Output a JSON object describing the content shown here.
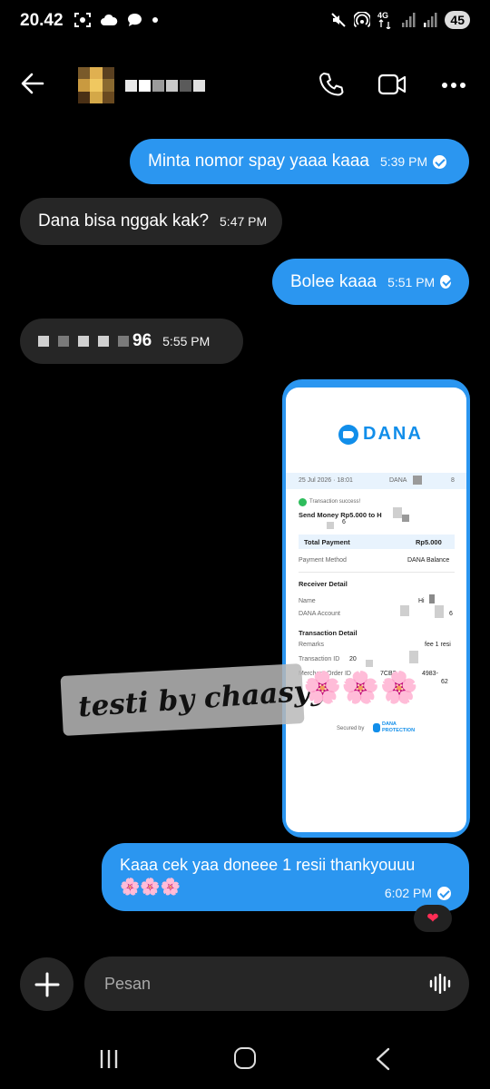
{
  "status_bar": {
    "time": "20.42",
    "left_icons": [
      "screenshot-icon",
      "cloud-icon",
      "chat-icon",
      "dot-icon"
    ],
    "right_icons": [
      "mute-icon",
      "hotspot-icon",
      "4g-signal-icon",
      "signal-icon",
      "signal-icon"
    ],
    "network": "4G",
    "battery": "45"
  },
  "header": {
    "back_icon": "arrow-left-icon",
    "call_icon": "phone-icon",
    "video_icon": "video-camera-icon",
    "more_icon": "more-dots-icon"
  },
  "messages": [
    {
      "direction": "outgoing",
      "text": "Minta nomor spay yaaa kaaa",
      "time": "5:39 PM",
      "status": "seen"
    },
    {
      "direction": "incoming",
      "text": "Dana bisa nggak kak?",
      "time": "5:47 PM"
    },
    {
      "direction": "outgoing",
      "text": "Bolee kaaa",
      "time": "5:51 PM",
      "status": "seen"
    },
    {
      "direction": "incoming",
      "text": "96",
      "time": "5:55 PM"
    },
    {
      "direction": "outgoing",
      "type": "image",
      "receipt": {
        "brand": "DANA",
        "datetime": "25 Jul 2026 · 18:01",
        "ref_prefix": "DANA",
        "ref_suffix": "8",
        "success": "Transaction success!",
        "send_line": "Send Money Rp5.000 to H",
        "send_line2": "6",
        "total_label": "Total Payment",
        "total_value": "Rp5.000",
        "method_label": "Payment Method",
        "method_value": "DANA Balance",
        "receiver_heading": "Receiver Detail",
        "name_label": "Name",
        "name_value": "Hi",
        "account_label": "DANA Account",
        "account_value": "6",
        "transaction_heading": "Transaction Detail",
        "remarks_label": "Remarks",
        "remarks_value": "fee 1 resi",
        "txid_label": "Transaction ID",
        "txid_value": "20",
        "merchant_label": "Merchant Order ID",
        "merchant_value": "7CB2",
        "merchant_value2": "4983-",
        "merchant_value3": "62",
        "secured_label": "Secured by",
        "protection_line1": "DANA",
        "protection_line2": "PROTECTION"
      },
      "watermark": "testi by chaasyy",
      "watermark_emoji": "🌸🌸🌸"
    },
    {
      "direction": "outgoing",
      "text": "Kaaa cek yaa doneee 1 resii thankyouuu",
      "emoji": "🌸🌸🌸",
      "time": "6:02 PM",
      "status": "seen",
      "reaction": "❤"
    }
  ],
  "composer": {
    "placeholder": "Pesan",
    "plus_icon": "plus-icon",
    "voice_icon": "voice-wave-icon"
  },
  "navbar": {
    "items": [
      "recent-apps-icon",
      "home-icon",
      "back-icon"
    ]
  },
  "colors": {
    "outgoing_bubble": "#2b96f0",
    "incoming_bubble": "#262626",
    "background": "#000000",
    "dana_blue": "#118eea",
    "reaction": "#ff2d55"
  }
}
